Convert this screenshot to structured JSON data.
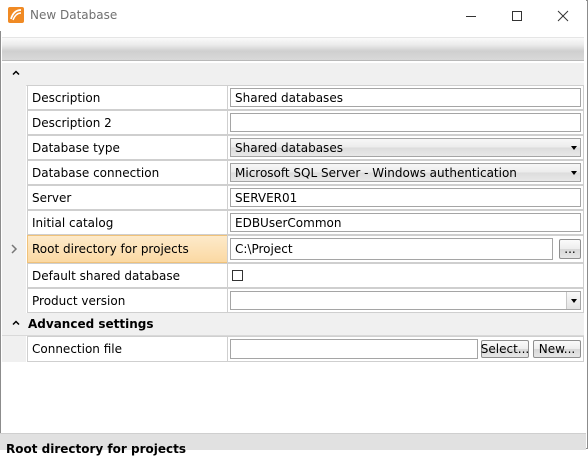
{
  "window": {
    "title": "New Database",
    "icon": "app-logo-icon",
    "accent_color": "#f08a24"
  },
  "categories": [
    {
      "label": "",
      "expanded": true
    },
    {
      "label": "Advanced settings",
      "expanded": true
    }
  ],
  "properties": {
    "description": {
      "label": "Description",
      "value": "Shared databases"
    },
    "description2": {
      "label": "Description 2",
      "value": ""
    },
    "database_type": {
      "label": "Database type",
      "value": "Shared databases"
    },
    "database_connection": {
      "label": "Database connection",
      "value": "Microsoft SQL Server - Windows authentication"
    },
    "server": {
      "label": "Server",
      "value": "SERVER01"
    },
    "initial_catalog": {
      "label": "Initial catalog",
      "value": "EDBUserCommon"
    },
    "root_directory": {
      "label": "Root directory for projects",
      "value": "C:\\Project",
      "browse_label": "..."
    },
    "default_shared": {
      "label": "Default shared database",
      "checked": false
    },
    "product_version": {
      "label": "Product version",
      "value": ""
    },
    "connection_file": {
      "label": "Connection file",
      "value": "",
      "select_label": "Select...",
      "new_label": "New..."
    }
  },
  "status": {
    "text": "Root directory for projects"
  }
}
